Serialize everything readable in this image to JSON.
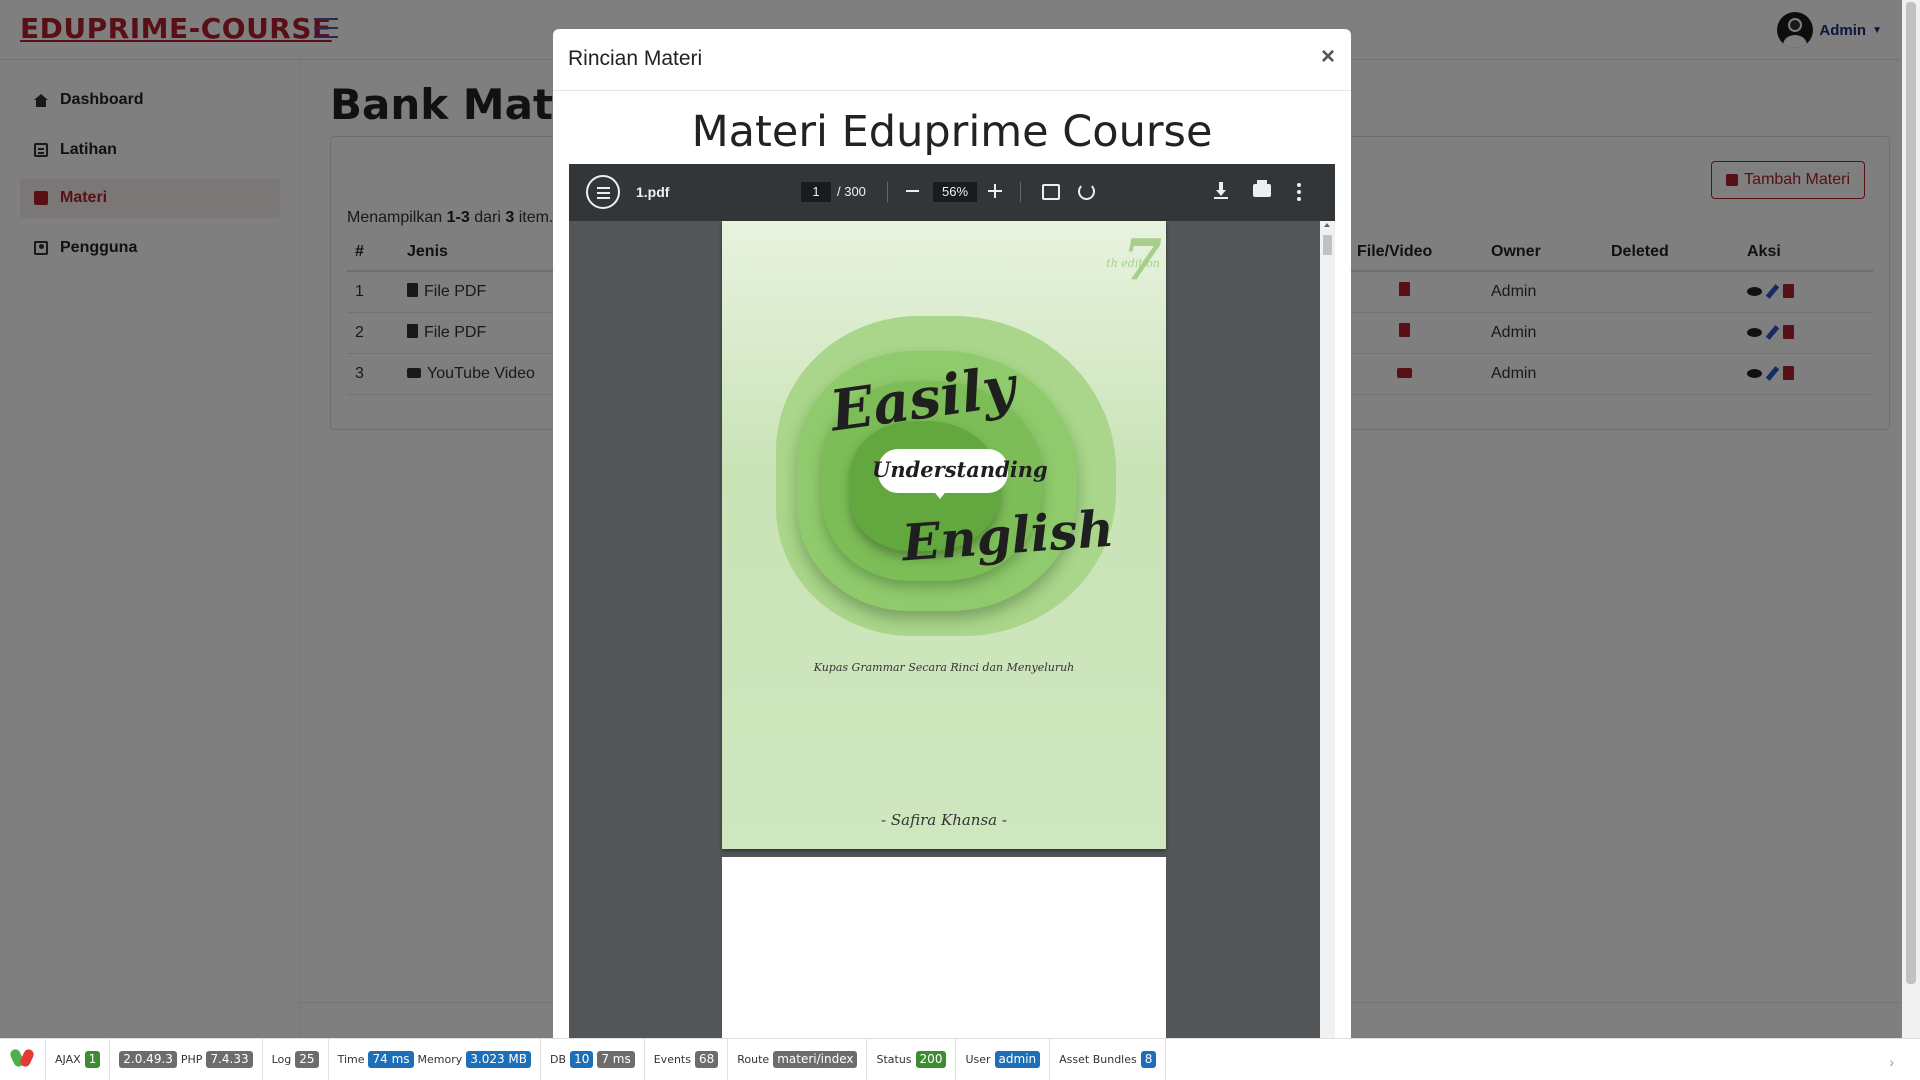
{
  "brand": "EDUPRIME-COURSE",
  "user": {
    "name": "Admin"
  },
  "sidebar": {
    "items": [
      {
        "label": "Dashboard",
        "icon": "home-icon"
      },
      {
        "label": "Latihan",
        "icon": "list-icon"
      },
      {
        "label": "Materi",
        "icon": "book-icon",
        "active": true
      },
      {
        "label": "Pengguna",
        "icon": "user-icon"
      }
    ]
  },
  "page": {
    "title": "Bank Materi",
    "add_button": "Tambah Materi",
    "summary_prefix": "Menampilkan",
    "summary_range": "1-3",
    "summary_mid": "dari",
    "summary_total": "3",
    "summary_suffix": "item."
  },
  "table": {
    "headers": {
      "no": "#",
      "jenis": "Jenis",
      "file": "File/Video",
      "owner": "Owner",
      "deleted": "Deleted",
      "aksi": "Aksi"
    },
    "rows": [
      {
        "no": "1",
        "jenis": "File PDF",
        "owner": "Admin"
      },
      {
        "no": "2",
        "jenis": "File PDF",
        "owner": "Admin"
      },
      {
        "no": "3",
        "jenis": "YouTube Video",
        "owner": "Admin"
      }
    ]
  },
  "modal": {
    "title": "Rincian Materi",
    "close": "×",
    "heading": "Materi Eduprime Course"
  },
  "viewer": {
    "filename": "1.pdf",
    "page": "1",
    "total": "/ 300",
    "zoom": "56%"
  },
  "cover": {
    "edition": "7",
    "edition_suffix": "th edition",
    "line1": "Easily",
    "line2": "Understanding",
    "line3": "English",
    "subtitle": "Kupas Grammar Secara Rinci dan Menyeluruh",
    "author": "- Safira Khansa -"
  },
  "debug": {
    "ajax_label": "AJAX",
    "ajax": "1",
    "version": "2.0.49.3",
    "php_label": "PHP",
    "php": "7.4.33",
    "log_label": "Log",
    "log": "25",
    "time_label": "Time",
    "time": "74 ms",
    "memory_label": "Memory",
    "memory": "3.023 MB",
    "db_label": "DB",
    "db_count": "10",
    "db_time": "7 ms",
    "events_label": "Events",
    "events": "68",
    "route_label": "Route",
    "route": "materi/index",
    "status_label": "Status",
    "status": "200",
    "user_label": "User",
    "user": "admin",
    "bundles_label": "Asset Bundles",
    "bundles": "8"
  }
}
